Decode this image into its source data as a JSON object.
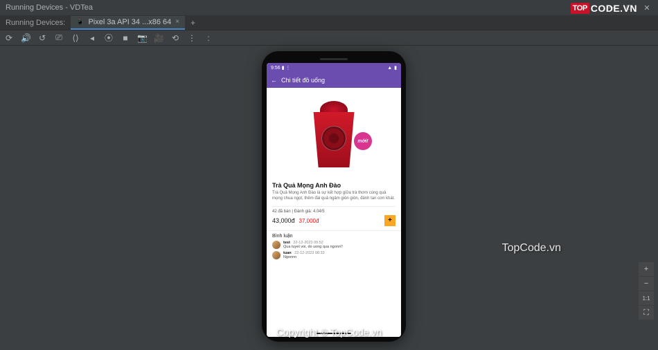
{
  "window": {
    "title": "Running Devices - VDTea",
    "minimize": "—",
    "maximize": "□",
    "close": "✕"
  },
  "tabs": {
    "panel_label": "Running Devices:",
    "active": "Pixel 3a API 34 ...x86 64",
    "close_x": "×",
    "add": "+"
  },
  "toolbar": {
    "icons": [
      "⟳",
      "🔊",
      "↺",
      "⎚",
      "⟨⟩",
      "◂",
      "⦿",
      "■",
      "📷",
      "🎥",
      "⟲",
      "⋮",
      ":"
    ]
  },
  "statusbar": {
    "time": "9:56",
    "battery_icon": "▮",
    "bt_icon": "⋮",
    "signal": "▲",
    "batt": "▮"
  },
  "app": {
    "back": "←",
    "header": "Chi tiết đồ uống",
    "badge_new": "mới!",
    "product_title": "Trà Quả Mọng Anh Đào",
    "product_desc": "Trà Quả Mọng Anh Đào là sự kết hợp giữa trà thơm cùng quả mọng chua ngọt, thêm đài quả ngâm giòn giòn, đánh tan cơn khát.",
    "meta_sold": "42 đã bán",
    "meta_sep": " | ",
    "meta_rating": "Đánh giá: 4.04/5",
    "price": "43,000đ",
    "price_sale": "37,000đ",
    "add": "+",
    "comments_header": "Bình luận",
    "comments": [
      {
        "user": "test",
        "date": "22-12-2023 09:52",
        "body": "Qua tuyet voi, do uong qua ngonn!!"
      },
      {
        "user": "tuan",
        "date": "22-12-2023 08:33",
        "body": "Ngonnn"
      }
    ]
  },
  "zoom": {
    "plus": "+",
    "minus": "−",
    "fit": "1:1",
    "full": "⛶"
  },
  "watermark": {
    "center": "Copyright © TopCode.vn",
    "right": "TopCode.vn",
    "logo_badge": "TOP",
    "logo_rest": "CODE.VN"
  }
}
